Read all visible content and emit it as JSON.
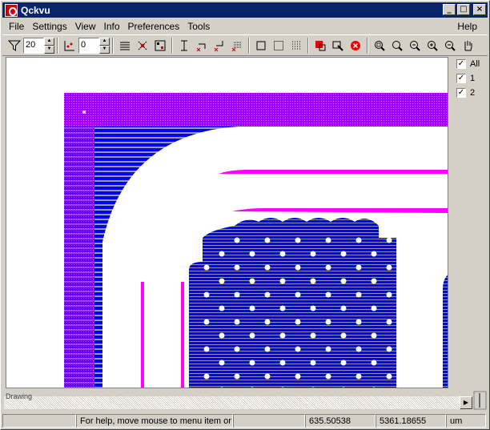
{
  "window": {
    "title": "Qckvu",
    "minimize": "_",
    "maximize": "□",
    "close": "×"
  },
  "menu": {
    "file": "File",
    "settings": "Settings",
    "view": "View",
    "info": "Info",
    "preferences": "Preferences",
    "tools": "Tools",
    "help": "Help"
  },
  "toolbar": {
    "filter_value": "20",
    "level_value": "0"
  },
  "layers": {
    "all": "All",
    "layer1": "1",
    "layer2": "2",
    "check": "✓"
  },
  "scrollbar": {
    "label": "Drawing"
  },
  "status": {
    "message": "For help, move mouse to menu item or to",
    "x": "635.50538",
    "y": "5361.18655",
    "units": "um"
  },
  "colors": {
    "purple": "#a000ff",
    "magenta": "#ff00ff",
    "blue": "#0000ff",
    "titlebar": "#0a246a"
  }
}
